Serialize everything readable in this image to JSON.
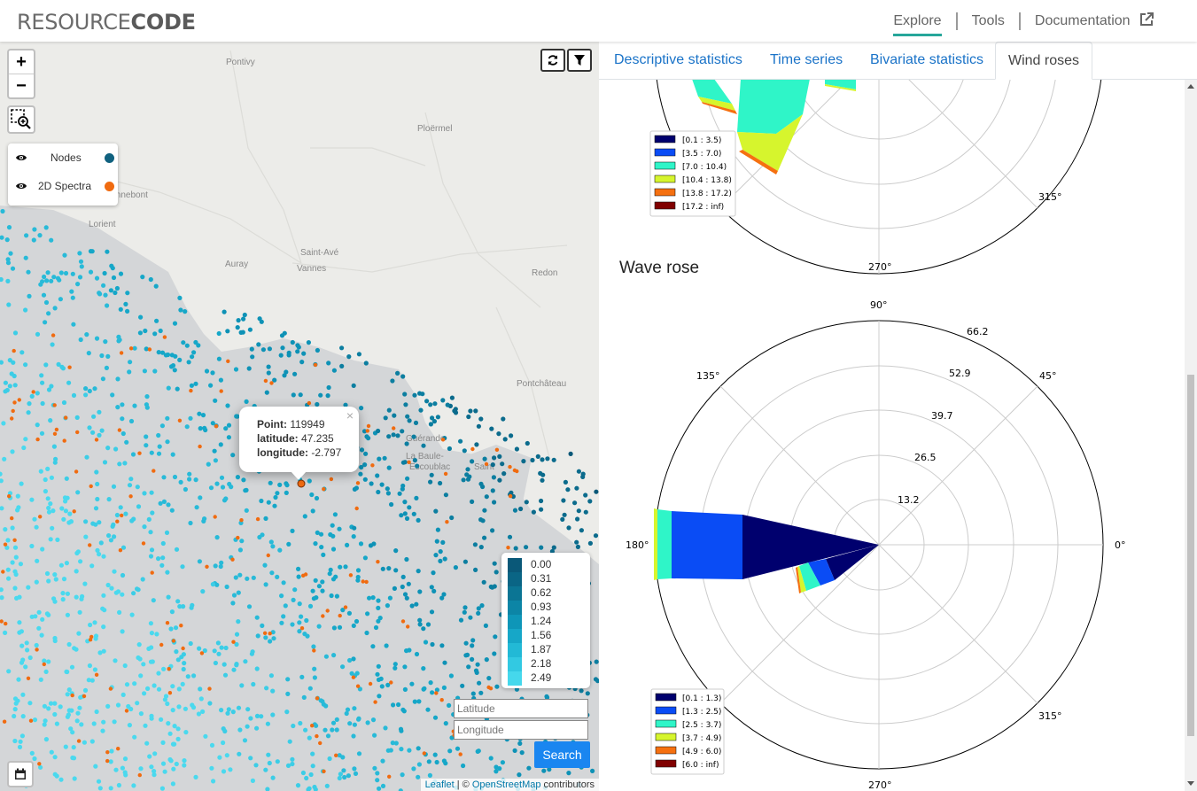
{
  "app": {
    "logo_light": "RESOURCE",
    "logo_bold": "CODE"
  },
  "nav": {
    "explore": "Explore",
    "tools": "Tools",
    "documentation": "Documentation"
  },
  "map": {
    "place_labels": [
      "Pontivy",
      "Ploërmel",
      "Hennebont",
      "Lorient",
      "Auray",
      "Saint-Avé",
      "Vannes",
      "Redon",
      "Pontchâteau",
      "Guérande",
      "La Baule-Escoublac",
      "Saint"
    ],
    "layers": [
      {
        "label": "Nodes",
        "color": "#10617f"
      },
      {
        "label": "2D Spectra",
        "color": "#f06b10"
      }
    ],
    "popup": {
      "point_label": "Point:",
      "point_value": "119949",
      "lat_label": "latitude:",
      "lat_value": "47.235",
      "lon_label": "longitude:",
      "lon_value": "-2.797",
      "close": "×"
    },
    "scale": [
      "0.00",
      "0.31",
      "0.62",
      "0.93",
      "1.24",
      "1.56",
      "1.87",
      "2.18",
      "2.49"
    ],
    "latitude_placeholder": "Latitude",
    "longitude_placeholder": "Longitude",
    "search_label": "Search",
    "attribution": {
      "leaflet": "Leaflet",
      "sep": " | © ",
      "osm": "OpenStreetMap",
      "tail": " contributors"
    },
    "icons": [
      "zoom-in-icon",
      "zoom-out-icon",
      "box-zoom-icon",
      "eye-icon",
      "refresh-icon",
      "filter-icon",
      "calendar-icon"
    ]
  },
  "tabs": [
    "Descriptive statistics",
    "Time series",
    "Bivariate statistics",
    "Wind roses"
  ],
  "active_tab": "Wind roses",
  "wind_rose": {
    "angle_labels": {
      "a315": "315°",
      "a270": "270°"
    },
    "legend": [
      "[0.1 : 3.5)",
      "[3.5 : 7.0)",
      "[7.0 : 10.4)",
      "[10.4 : 13.8)",
      "[13.8 : 17.2)",
      "[17.2 : inf)"
    ]
  },
  "wave_rose": {
    "title": "Wave rose",
    "angle_labels": {
      "a90": "90°",
      "a135": "135°",
      "a45": "45°",
      "a180": "180°",
      "a0": "0°",
      "a315": "315°",
      "a270": "270°"
    },
    "radial_labels": [
      "13.2",
      "26.5",
      "39.7",
      "52.9",
      "66.2"
    ],
    "legend": [
      "[0.1 : 1.3)",
      "[1.3 : 2.5)",
      "[2.5 : 3.7)",
      "[3.7 : 4.9)",
      "[4.9 : 6.0)",
      "[6.0 : inf)"
    ]
  },
  "colors": {
    "bin1": "#00006e",
    "bin2": "#0a4cf5",
    "bin3": "#2ff5c8",
    "bin4": "#d6f52d",
    "bin5": "#f57010",
    "bin6": "#800000",
    "accent": "#26a69a",
    "link": "#1a73c8",
    "search_button": "#1a86f0"
  }
}
